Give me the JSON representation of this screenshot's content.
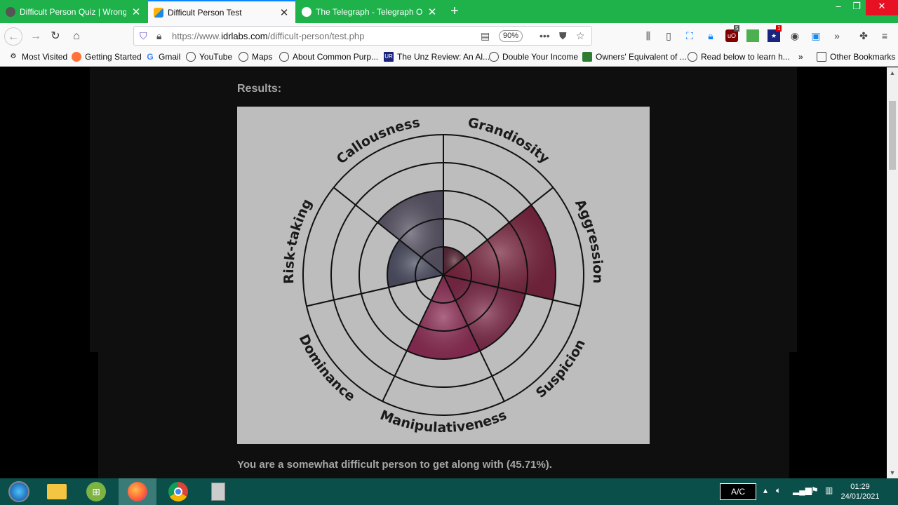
{
  "tabs": [
    {
      "title": "Difficult Person Quiz | Wrong P",
      "active": false
    },
    {
      "title": "Difficult Person Test",
      "active": true
    },
    {
      "title": "The Telegraph - Telegraph Onl",
      "active": false
    }
  ],
  "nav": {
    "url_prefix": "https://www.",
    "url_domain": "idrlabs.com",
    "url_path": "/difficult-person/test.php",
    "zoom": "90%"
  },
  "bookmarks": [
    "Most Visited",
    "Getting Started",
    "Gmail",
    "YouTube",
    "Maps",
    "About Common Purp...",
    "The Unz Review: An Al...",
    "Double Your Income",
    "Owners' Equivalent of ...",
    "Read below to learn h...",
    "Other Bookmarks"
  ],
  "extension_badges": {
    "ublock": "5",
    "news": "1"
  },
  "page": {
    "results_label": "Results:",
    "result_text": "You are a somewhat difficult person to get along with (45.71%)."
  },
  "chart_data": {
    "type": "polar-area",
    "categories": [
      "Grandiosity",
      "Aggression",
      "Suspicion",
      "Manipulativeness",
      "Dominance",
      "Risk-taking",
      "Callousness"
    ],
    "values": [
      1,
      4,
      3,
      3,
      0,
      2,
      3
    ],
    "rmax": 5,
    "colors": [
      "#5a2a3a",
      "#7a2640",
      "#7e2a48",
      "#8e2e56",
      "#6a3048",
      "#4e5064",
      "#5a5566"
    ]
  },
  "taskbar": {
    "ac_label": "A/C",
    "time": "01:29",
    "date": "24/01/2021"
  }
}
